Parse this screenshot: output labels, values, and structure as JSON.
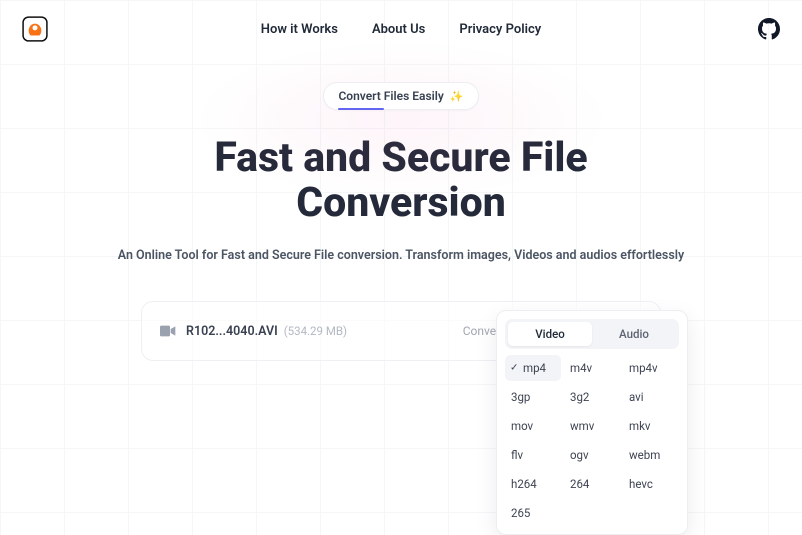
{
  "header": {
    "nav": [
      {
        "label": "How it Works"
      },
      {
        "label": "About Us"
      },
      {
        "label": "Privacy Policy"
      }
    ]
  },
  "hero": {
    "pill_label": "Convert Files Easily",
    "title_line1": "Fast and Secure File",
    "title_line2": "Conversion",
    "subtitle": "An Online Tool for Fast and Secure File conversion. Transform images, Videos and audios effortlessly"
  },
  "file": {
    "name": "R102...4040.AVI",
    "size": "(534.29 MB)",
    "convert_label": "Convert to",
    "selected_format": "mp4"
  },
  "popover": {
    "tabs": [
      {
        "label": "Video",
        "active": true
      },
      {
        "label": "Audio",
        "active": false
      }
    ],
    "options": [
      "mp4",
      "m4v",
      "mp4v",
      "3gp",
      "3g2",
      "avi",
      "mov",
      "wmv",
      "mkv",
      "flv",
      "ogv",
      "webm",
      "h264",
      "264",
      "hevc",
      "265"
    ],
    "selected": "mp4"
  }
}
